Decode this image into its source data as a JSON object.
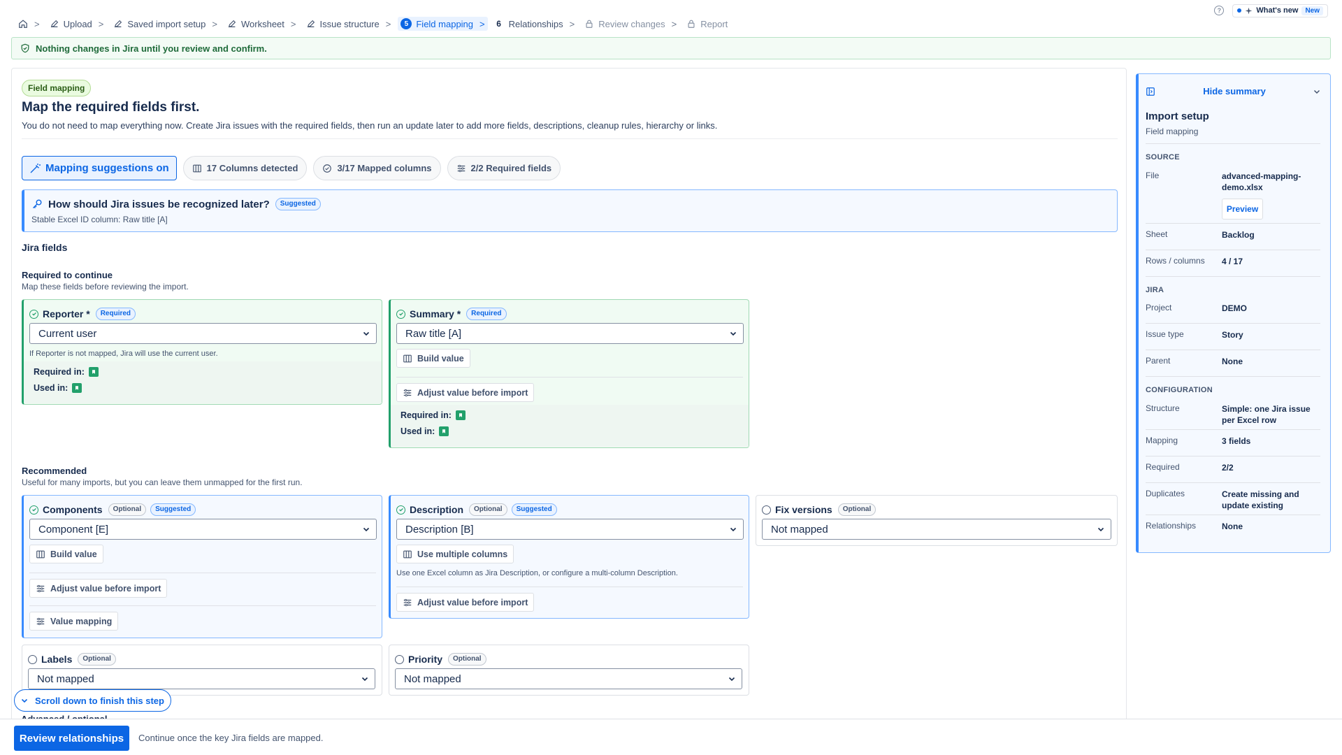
{
  "breadcrumb": [
    {
      "label": "Upload",
      "state": "done"
    },
    {
      "label": "Saved import setup",
      "state": "done"
    },
    {
      "label": "Worksheet",
      "state": "done"
    },
    {
      "label": "Issue structure",
      "state": "done"
    },
    {
      "label": "Field mapping",
      "state": "active",
      "number": "5"
    },
    {
      "label": "Relationships",
      "state": "next",
      "number": "6"
    },
    {
      "label": "Review changes",
      "state": "locked"
    },
    {
      "label": "Report",
      "state": "locked"
    }
  ],
  "header": {
    "whats_new": "What's new",
    "new_badge": "New"
  },
  "notice": "Nothing changes in Jira until you review and confirm.",
  "main": {
    "pill": "Field mapping",
    "title": "Map the required fields first.",
    "subtitle": "You do not need to map everything now. Create Jira issues with the required fields, then run an update later to add more fields, descriptions, cleanup rules, hierarchy or links.",
    "chips": {
      "suggestions": "Mapping suggestions on",
      "columns": "17 Columns detected",
      "mapped": "3/17 Mapped columns",
      "required": "2/2 Required fields"
    },
    "recognize": {
      "title": "How should Jira issues be recognized later?",
      "badge": "Suggested",
      "desc": "Stable Excel ID column: Raw title [A]"
    },
    "jira_fields": "Jira fields",
    "required_section": {
      "title": "Required to continue",
      "desc": "Map these fields before reviewing the import."
    },
    "recommended_section": {
      "title": "Recommended",
      "desc": "Useful for many imports, but you can leave them unmapped for the first run."
    }
  },
  "fields": {
    "reporter": {
      "name": "Reporter *",
      "badge": "Required",
      "value": "Current user",
      "note": "If Reporter is not mapped, Jira will use the current user.",
      "required_in": "Required in:",
      "used_in": "Used in:"
    },
    "summary": {
      "name": "Summary *",
      "badge": "Required",
      "value": "Raw title [A]",
      "build": "Build value",
      "adjust": "Adjust value before import",
      "required_in": "Required in:",
      "used_in": "Used in:"
    },
    "components": {
      "name": "Components",
      "badge1": "Optional",
      "badge2": "Suggested",
      "value": "Component [E]",
      "build": "Build value",
      "adjust": "Adjust value before import",
      "value_mapping": "Value mapping"
    },
    "description": {
      "name": "Description",
      "badge1": "Optional",
      "badge2": "Suggested",
      "value": "Description [B]",
      "multi": "Use multiple columns",
      "note": "Use one Excel column as Jira Description, or configure a multi-column Description.",
      "adjust": "Adjust value before import"
    },
    "fix_versions": {
      "name": "Fix versions",
      "badge": "Optional",
      "value": "Not mapped"
    },
    "labels": {
      "name": "Labels",
      "badge": "Optional",
      "value": "Not mapped"
    },
    "priority": {
      "name": "Priority",
      "badge": "Optional",
      "value": "Not mapped"
    }
  },
  "summary_panel": {
    "hide": "Hide summary",
    "title": "Import setup",
    "subtitle": "Field mapping",
    "source_label": "SOURCE",
    "file_key": "File",
    "file_val": "advanced-mapping-demo.xlsx",
    "preview": "Preview",
    "sheet_key": "Sheet",
    "sheet_val": "Backlog",
    "rows_key": "Rows / columns",
    "rows_val": "4 / 17",
    "jira_label": "JIRA",
    "project_key": "Project",
    "project_val": "DEMO",
    "issuetype_key": "Issue type",
    "issuetype_val": "Story",
    "parent_key": "Parent",
    "parent_val": "None",
    "config_label": "CONFIGURATION",
    "structure_key": "Structure",
    "structure_val": "Simple: one Jira issue per Excel row",
    "mapping_key": "Mapping",
    "mapping_val": "3 fields",
    "required_key": "Required",
    "required_val": "2/2",
    "duplicates_key": "Duplicates",
    "duplicates_val": "Create missing and update existing",
    "relationships_key": "Relationships",
    "relationships_val": "None"
  },
  "bottom": {
    "scroll_hint": "Scroll down to finish this step",
    "advanced": "Advanced / optional",
    "primary": "Review relationships",
    "message": "Continue once the key Jira fields are mapped."
  },
  "colors": {
    "accent": "#0c66e4",
    "success": "#22a06b"
  }
}
